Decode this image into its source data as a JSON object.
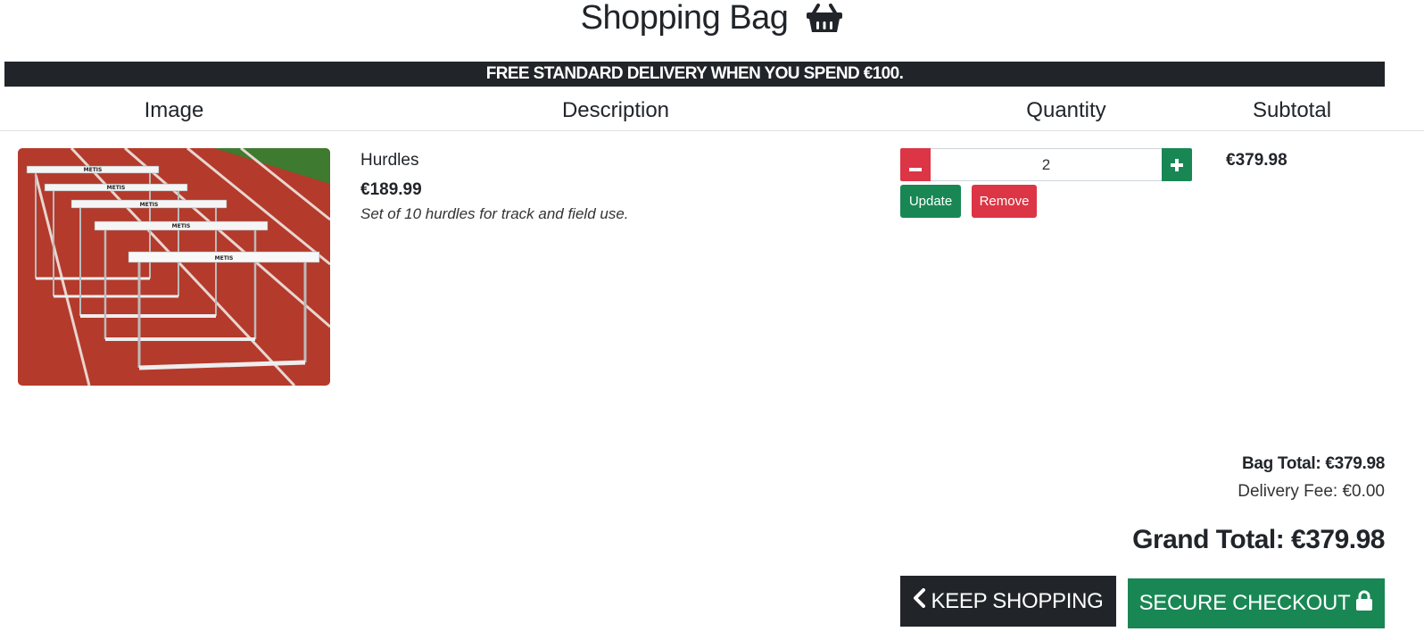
{
  "header": {
    "title": "Shopping Bag",
    "icon": "basket-icon"
  },
  "banner": {
    "text": "FREE STANDARD DELIVERY WHEN YOU SPEND €100."
  },
  "table": {
    "headers": [
      "Image",
      "Description",
      "Quantity",
      "Subtotal"
    ]
  },
  "items": [
    {
      "name": "Hurdles",
      "price": "€189.99",
      "description": "Set of 10 hurdles for track and field use.",
      "quantity": "2",
      "subtotal": "€379.98",
      "update_label": "Update",
      "remove_label": "Remove",
      "image_brand_text": "METIS"
    }
  ],
  "summary": {
    "bag_total": "Bag Total: €379.98",
    "delivery_fee": "Delivery Fee: €0.00",
    "grand_total": "Grand Total: €379.98"
  },
  "actions": {
    "keep_shopping": "KEEP SHOPPING",
    "secure_checkout": "SECURE CHECKOUT"
  },
  "colors": {
    "dark": "#212529",
    "success": "#198754",
    "danger": "#dc3545"
  }
}
